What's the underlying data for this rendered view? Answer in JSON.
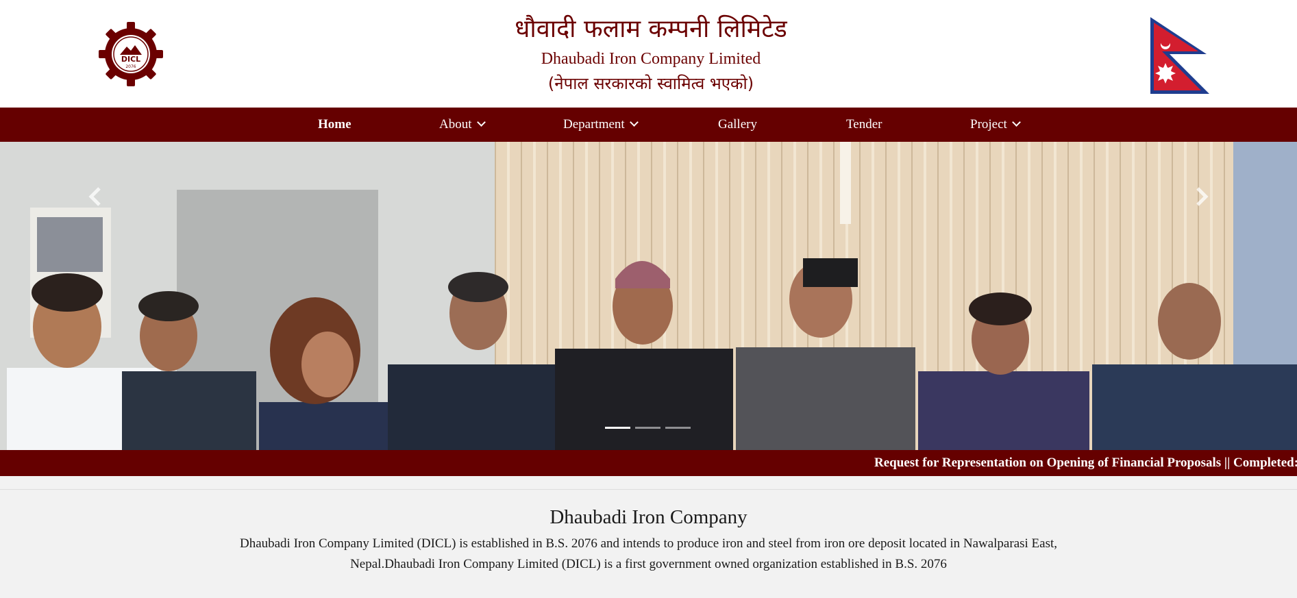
{
  "header": {
    "logo_icon": "dicl-gear-logo",
    "logo_text": "DICL",
    "logo_year": "2076",
    "title_np": "धौवादी फलाम कम्पनी लिमिटेड",
    "title_en": "Dhaubadi Iron Company Limited",
    "subtitle_np": "(नेपाल सरकारको स्वामित्व भएको)",
    "flag_icon": "nepal-flag-icon",
    "brand_color": "#650000"
  },
  "nav": {
    "items": [
      {
        "label": "Home",
        "active": true,
        "dropdown": false
      },
      {
        "label": "About",
        "active": false,
        "dropdown": true
      },
      {
        "label": "Department",
        "active": false,
        "dropdown": true
      },
      {
        "label": "Gallery",
        "active": false,
        "dropdown": false
      },
      {
        "label": "Tender",
        "active": false,
        "dropdown": false
      },
      {
        "label": "Project",
        "active": false,
        "dropdown": true
      }
    ]
  },
  "slider": {
    "prev_icon": "chevron-left-icon",
    "next_icon": "chevron-right-icon",
    "slide_count": 3,
    "active_slide": 1
  },
  "ticker": {
    "text": "Request for Representation on Opening of Financial Proposals || Completed:"
  },
  "about": {
    "heading": "Dhaubadi Iron Company",
    "body_line1": "Dhaubadi Iron Company Limited (DICL) is established in B.S. 2076 and intends to produce iron and steel from iron ore deposit located in Nawalparasi East,",
    "body_line2": "Nepal.Dhaubadi Iron Company Limited (DICL) is a first government owned organization established in B.S. 2076"
  }
}
